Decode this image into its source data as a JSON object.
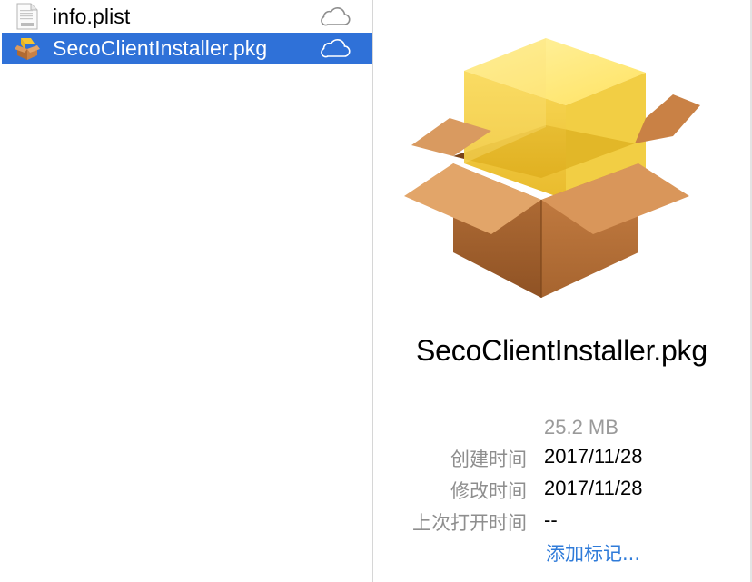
{
  "files": [
    {
      "name": "info.plist",
      "icon": "plist-file-icon",
      "status_icon": "icloud-icon",
      "selected": false
    },
    {
      "name": "SecoClientInstaller.pkg",
      "icon": "package-icon",
      "status_icon": "icloud-icon",
      "selected": true
    }
  ],
  "preview": {
    "icon": "package-icon",
    "title": "SecoClientInstaller.pkg",
    "size": "25.2 MB",
    "rows": [
      {
        "label": "创建时间",
        "value": "2017/11/28"
      },
      {
        "label": "修改时间",
        "value": "2017/11/28"
      },
      {
        "label": "上次打开时间",
        "value": "--"
      }
    ],
    "add_tags": "添加标记..."
  },
  "colors": {
    "selection": "#2f71d8",
    "link": "#2f7bd9",
    "secondary_text": "#8e8e8e"
  }
}
